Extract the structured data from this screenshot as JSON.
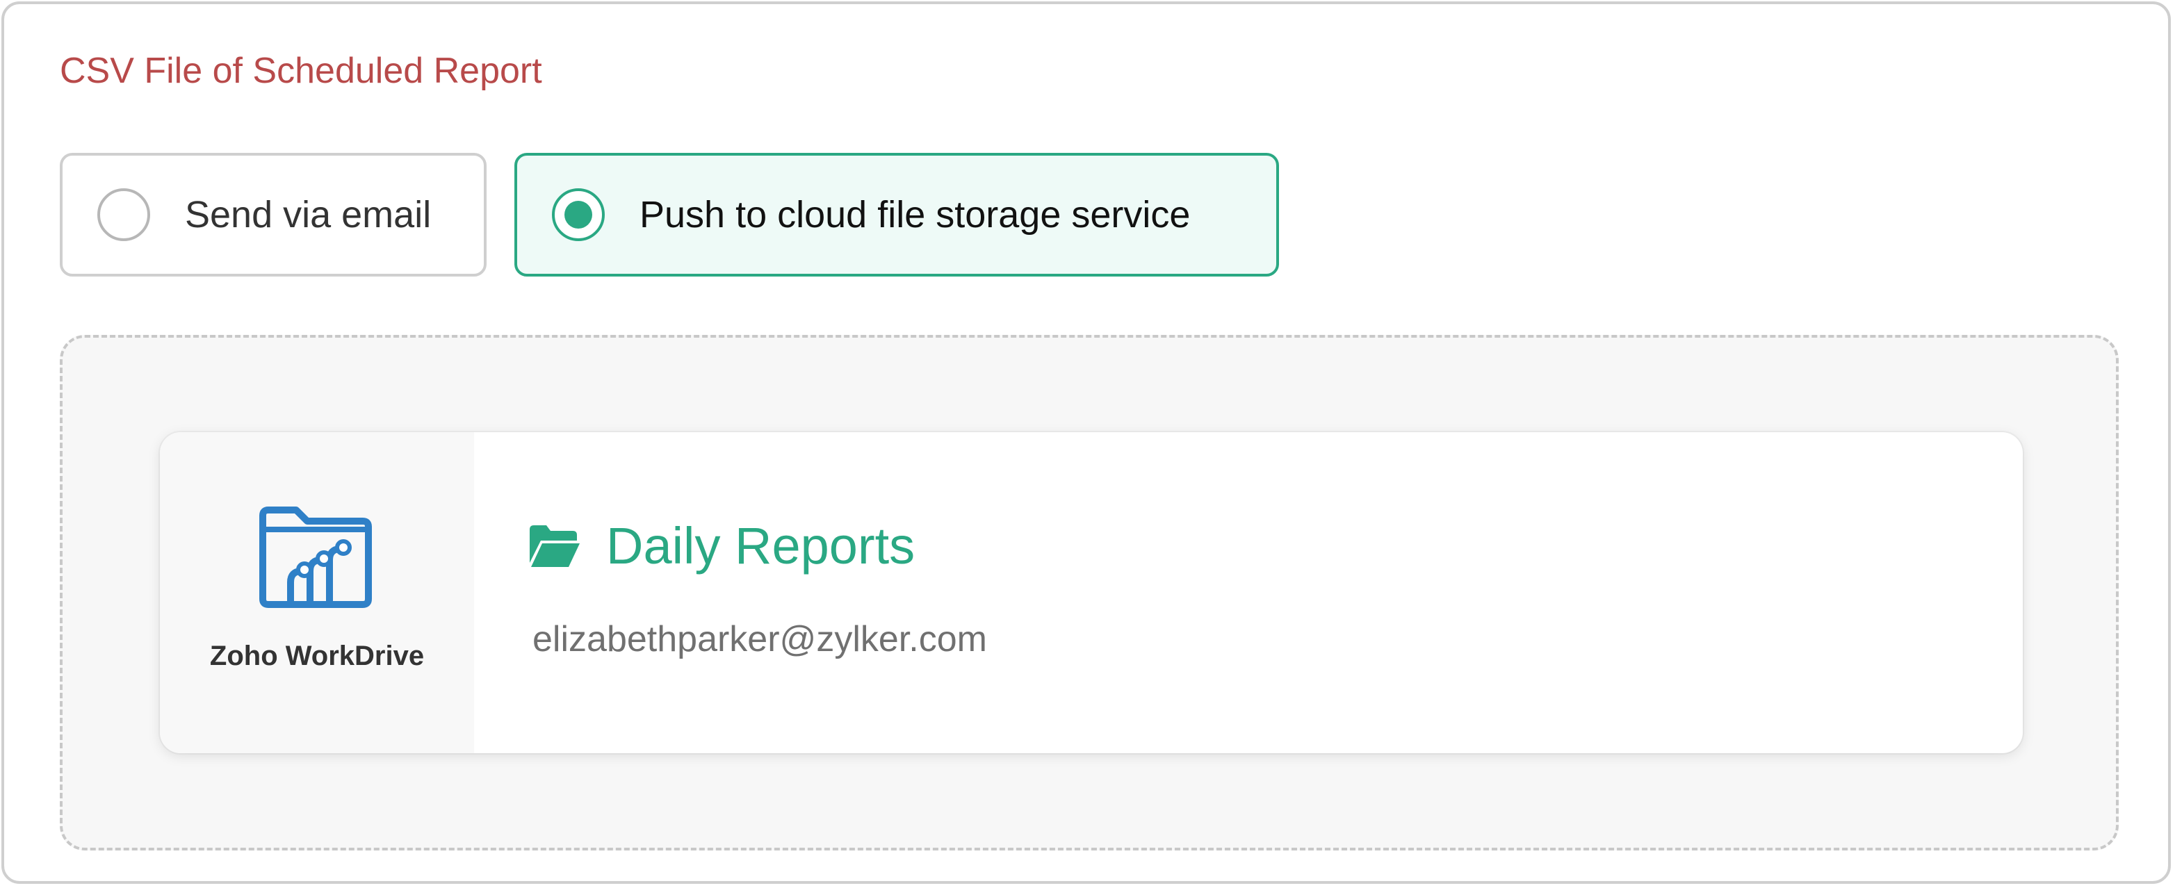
{
  "section": {
    "title": "CSV File of Scheduled Report"
  },
  "delivery_options": [
    {
      "label": "Send via email",
      "selected": false
    },
    {
      "label": "Push to cloud file storage service",
      "selected": true
    }
  ],
  "destination": {
    "service_name": "Zoho WorkDrive",
    "service_icon": "zoho-workdrive-logo",
    "folder_icon": "folder-open-icon",
    "folder_name": "Daily Reports",
    "account_email": "elizabethparker@zylker.com"
  },
  "colors": {
    "title": "#b84a4a",
    "accent": "#2aa883",
    "selected_background": "#eefaf7",
    "workdrive_blue": "#2f80c7"
  }
}
